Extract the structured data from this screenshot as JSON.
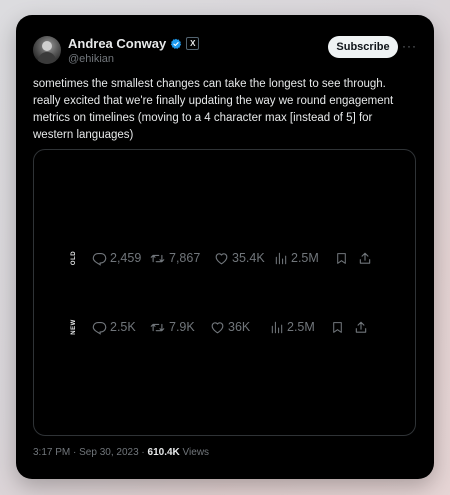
{
  "author": {
    "name": "Andrea Conway",
    "handle": "@ehikian",
    "x_badge": "X"
  },
  "actions": {
    "subscribe_label": "Subscribe",
    "more_label": "···"
  },
  "tweet": {
    "lines": [
      "sometimes the smallest changes can take the longest to see through.",
      "really excited that we're finally updating the way we round engagement",
      "metrics on timelines (moving to a 4 character max [instead of 5] for",
      "western languages)"
    ]
  },
  "media": {
    "rows": [
      {
        "label": "OLD",
        "replies": "2,459",
        "reposts": "7,867",
        "likes": "35.4K",
        "views": "2.5M"
      },
      {
        "label": "NEW",
        "replies": "2.5K",
        "reposts": "7.9K",
        "likes": "36K",
        "views": "2.5M"
      }
    ]
  },
  "footer": {
    "timestamp": "3:17 PM · Sep 30, 2023 · ",
    "views_count": "610.4K",
    "views_label": " Views"
  },
  "icons": {
    "verified": "verified-badge-icon",
    "reply": "reply-icon",
    "repost": "repost-icon",
    "like": "heart-icon",
    "views": "bar-chart-icon",
    "bookmark": "bookmark-icon",
    "share": "share-icon"
  },
  "colors": {
    "background": "#000000",
    "text_primary": "#e7e9ea",
    "text_secondary": "#71767b",
    "verified_blue": "#1d9bf0",
    "border": "#2f3336"
  }
}
